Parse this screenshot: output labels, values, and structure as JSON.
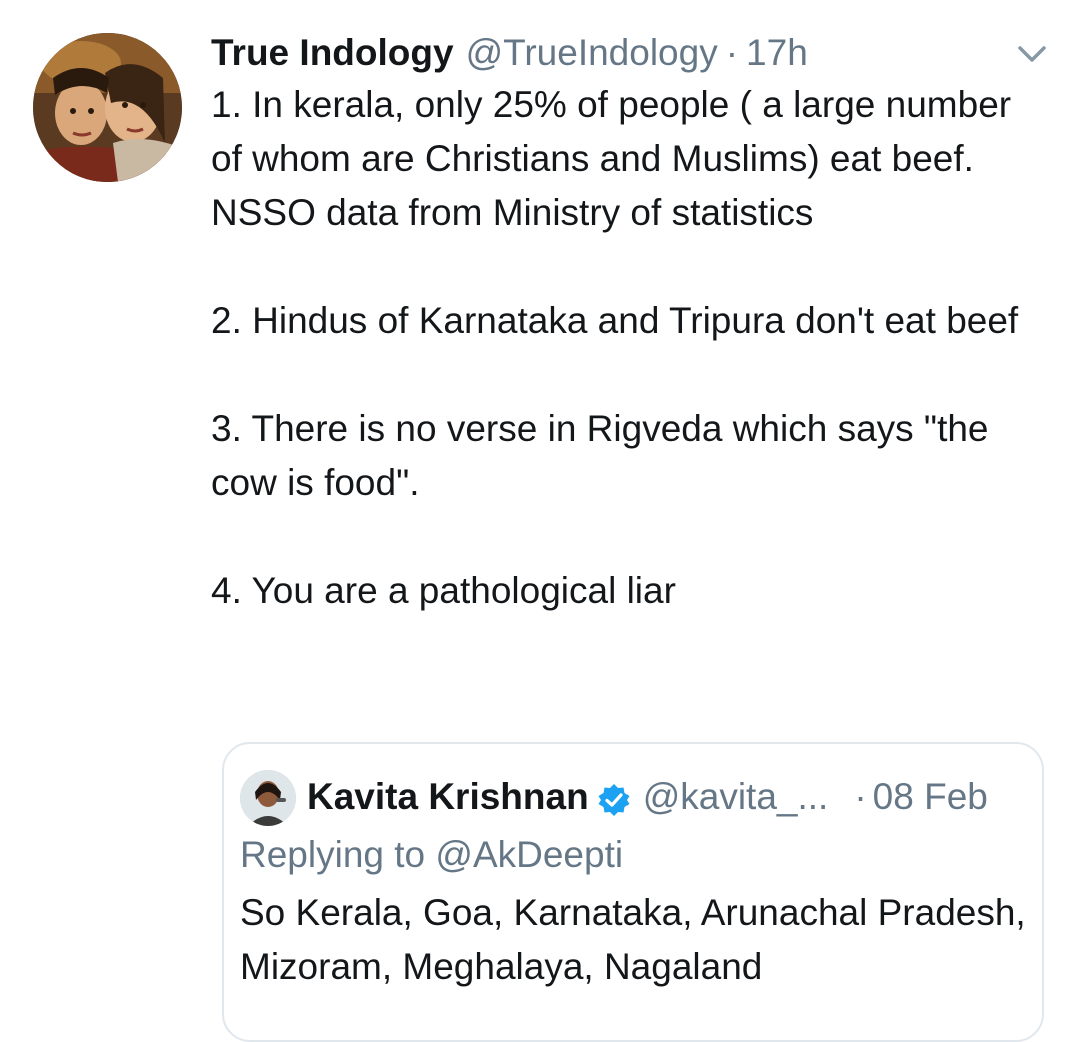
{
  "tweet": {
    "author_name": "True Indology",
    "author_handle": "@TrueIndology",
    "separator": "·",
    "time": "17h",
    "paragraphs": [
      "1. In kerala, only 25% of people ( a large number of whom are Christians and Muslims) eat beef. NSSO data from Ministry of statistics",
      "2. Hindus of Karnataka and Tripura don't eat beef",
      "3. There is no verse in Rigveda which says \"the cow is food\".",
      "4. You are a pathological liar"
    ],
    "caret_icon": "chevron-down-icon"
  },
  "quoted_tweet": {
    "author_name": "Kavita Krishnan",
    "verified_icon": "verified-badge-icon",
    "author_handle": "@kavita_...",
    "separator": "·",
    "time": "08 Feb",
    "replying_to": "Replying to @AkDeepti",
    "text": "So Kerala, Goa, Karnataka, Arunachal Pradesh, Mizoram, Meghalaya, Nagaland"
  },
  "colors": {
    "text_primary": "#14171a",
    "text_secondary": "#657786",
    "verified_blue": "#1da1f2",
    "border": "#e1e8ed"
  }
}
